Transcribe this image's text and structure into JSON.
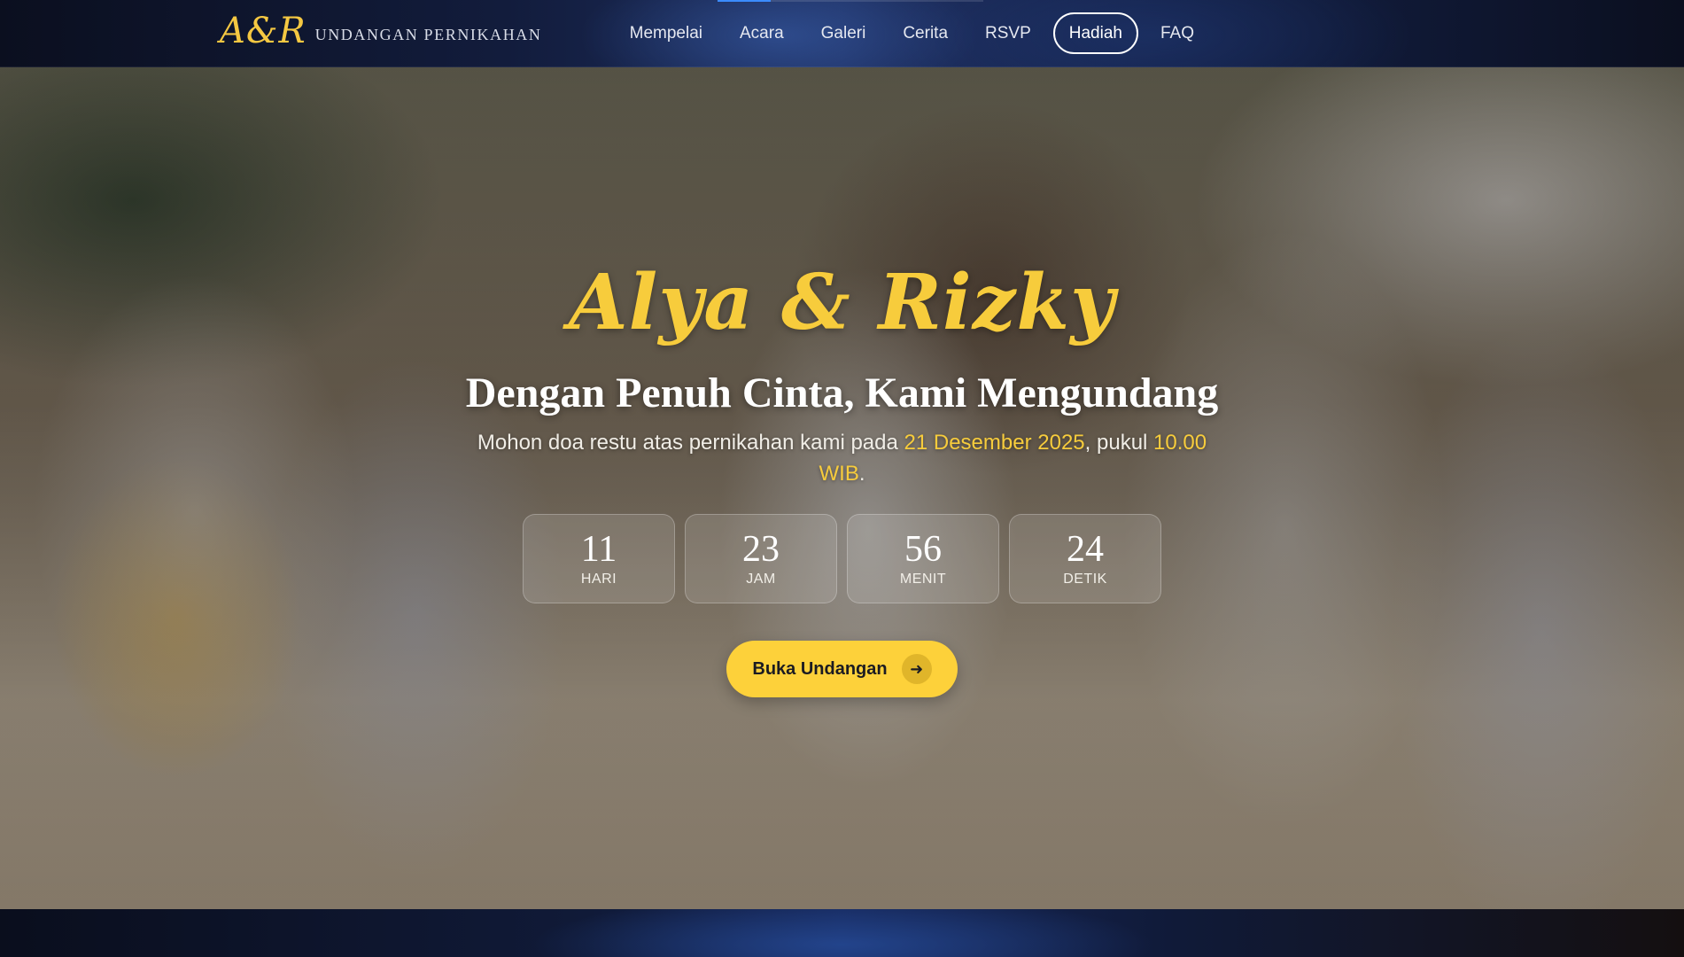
{
  "brand": {
    "mark": "A&R",
    "text": "UNDANGAN PERNIKAHAN"
  },
  "nav": {
    "scroll_progress": 0.2,
    "items": [
      {
        "label": "Mempelai",
        "active": false
      },
      {
        "label": "Acara",
        "active": false
      },
      {
        "label": "Galeri",
        "active": false
      },
      {
        "label": "Cerita",
        "active": false
      },
      {
        "label": "RSVP",
        "active": false
      },
      {
        "label": "Hadiah",
        "active": true
      },
      {
        "label": "FAQ",
        "active": false
      }
    ]
  },
  "hero": {
    "names": "Alya & Rizky",
    "title": "Dengan Penuh Cinta, Kami Mengundang",
    "subtitle_prefix": "Mohon doa restu atas pernikahan kami pada ",
    "date": "21 Desember 2025",
    "subtitle_middle": ", pukul ",
    "time": "10.00 WIB",
    "subtitle_suffix": "."
  },
  "countdown": [
    {
      "value": "11",
      "label": "HARI"
    },
    {
      "value": "23",
      "label": "JAM"
    },
    {
      "value": "56",
      "label": "MENIT"
    },
    {
      "value": "24",
      "label": "DETIK"
    }
  ],
  "cta": {
    "label": "Buka Undangan",
    "icon": "arrow-right-icon"
  },
  "colors": {
    "accent": "#f7cc3c",
    "button": "#fdd13a",
    "nav_bg": "#121c3c"
  }
}
